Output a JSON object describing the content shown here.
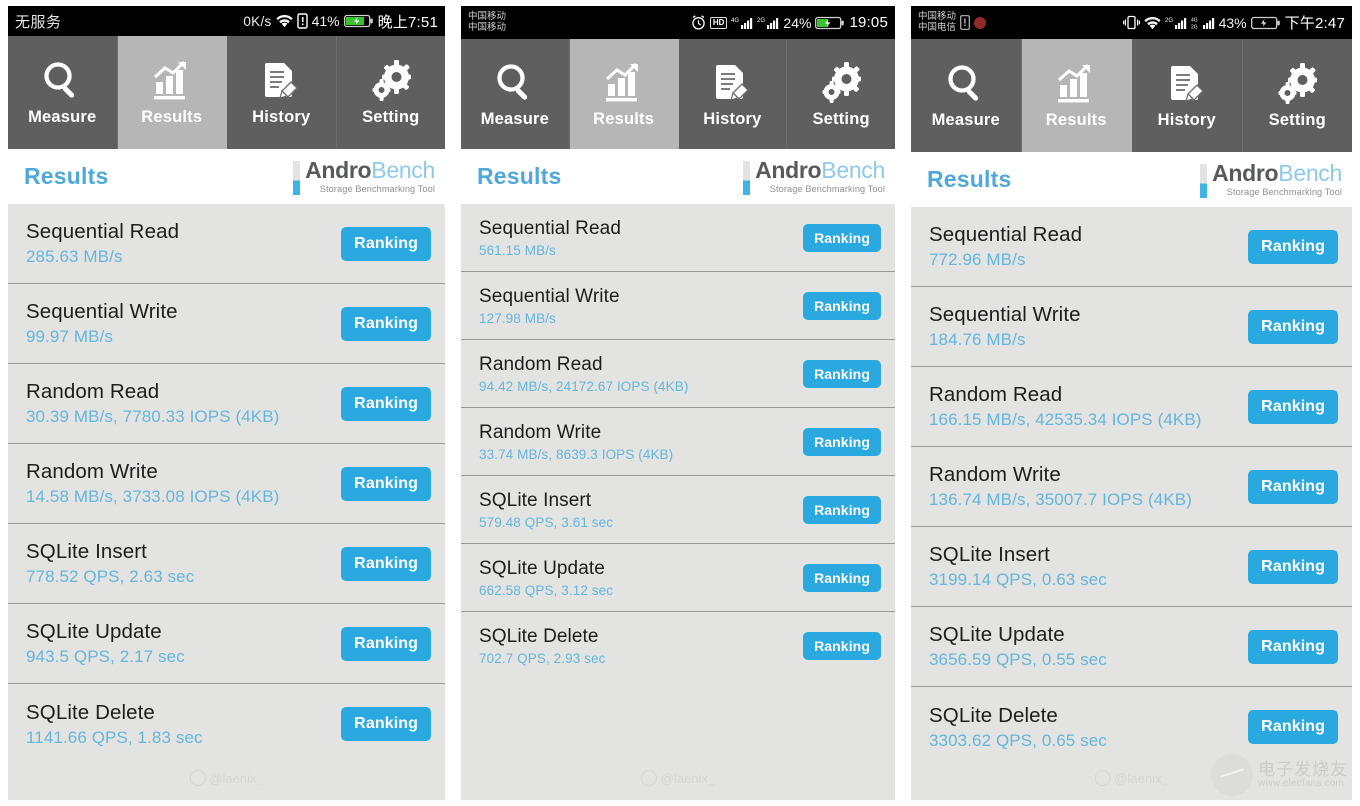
{
  "app": {
    "title": "Results",
    "logo_main_dark": "Andro",
    "logo_main_light": "Bench",
    "logo_tagline": "Storage Benchmarking Tool",
    "accent_blue": "#2aa9e0",
    "value_blue": "#64b6dd",
    "title_blue": "#4fa9d8",
    "tab_inactive_bg": "#5f5f5f",
    "tab_active_bg": "#b6b6b6",
    "list_bg": "#e3e3e1"
  },
  "tabs": [
    {
      "label": "Measure",
      "icon": "magnifier-icon",
      "active": false
    },
    {
      "label": "Results",
      "icon": "bar-chart-icon",
      "active": true
    },
    {
      "label": "History",
      "icon": "document-pencil-icon",
      "active": false
    },
    {
      "label": "Setting",
      "icon": "gears-icon",
      "active": false
    }
  ],
  "ranking_label": "Ranking",
  "watermarks": {
    "weibo": "@laenix_",
    "fans_cn": "电子发烧友",
    "fans_url": "www.elecfans.com"
  },
  "panels": [
    {
      "statusbar": {
        "carrier": "无服务",
        "carrier_line2": "",
        "net_speed": "0K/s",
        "battery_pct": "41%",
        "clock": "晚上7:51",
        "icons": [
          "wifi-icon",
          "sim-alert-icon",
          "battery-charging-icon"
        ]
      },
      "results": [
        {
          "name": "Sequential Read",
          "value": "285.63 MB/s"
        },
        {
          "name": "Sequential Write",
          "value": "99.97 MB/s"
        },
        {
          "name": "Random Read",
          "value": "30.39 MB/s, 7780.33 IOPS (4KB)"
        },
        {
          "name": "Random Write",
          "value": "14.58 MB/s, 3733.08 IOPS (4KB)"
        },
        {
          "name": "SQLite Insert",
          "value": "778.52 QPS, 2.63 sec"
        },
        {
          "name": "SQLite Update",
          "value": "943.5 QPS, 2.17 sec"
        },
        {
          "name": "SQLite Delete",
          "value": "1141.66 QPS, 1.83 sec"
        }
      ]
    },
    {
      "statusbar": {
        "carrier": "中国移动",
        "carrier_line2": "中国移动",
        "net_speed": "",
        "battery_pct": "24%",
        "clock": "19:05",
        "hd_badge": "HD",
        "signal_4g": "4G",
        "signal_2g": "2G",
        "icons": [
          "alarm-icon",
          "hd-icon",
          "signal-4g-icon",
          "signal-2g-icon",
          "battery-charging-icon"
        ]
      },
      "results": [
        {
          "name": "Sequential Read",
          "value": "561.15 MB/s"
        },
        {
          "name": "Sequential Write",
          "value": "127.98 MB/s"
        },
        {
          "name": "Random Read",
          "value": "94.42 MB/s, 24172.67 IOPS (4KB)"
        },
        {
          "name": "Random Write",
          "value": "33.74 MB/s, 8639.3 IOPS (4KB)"
        },
        {
          "name": "SQLite Insert",
          "value": "579.48 QPS, 3.61 sec"
        },
        {
          "name": "SQLite Update",
          "value": "662.58 QPS, 3.12 sec"
        },
        {
          "name": "SQLite Delete",
          "value": "702.7 QPS, 2.93 sec"
        }
      ]
    },
    {
      "statusbar": {
        "carrier": "中国移动",
        "carrier_line2": "中国电信",
        "net_speed": "",
        "battery_pct": "43%",
        "clock": "下午2:47",
        "signal_2g": "2G",
        "signal_4g": "4G",
        "icons": [
          "vibrate-icon",
          "wifi-icon",
          "signal-2g-icon",
          "signal-4g-icon",
          "battery-charging-icon",
          "sim-icon",
          "notification-badge-icon"
        ]
      },
      "results": [
        {
          "name": "Sequential Read",
          "value": "772.96 MB/s"
        },
        {
          "name": "Sequential Write",
          "value": "184.76 MB/s"
        },
        {
          "name": "Random Read",
          "value": "166.15 MB/s, 42535.34 IOPS (4KB)"
        },
        {
          "name": "Random Write",
          "value": "136.74 MB/s, 35007.7 IOPS (4KB)"
        },
        {
          "name": "SQLite Insert",
          "value": "3199.14 QPS, 0.63 sec"
        },
        {
          "name": "SQLite Update",
          "value": "3656.59 QPS, 0.55 sec"
        },
        {
          "name": "SQLite Delete",
          "value": "3303.62 QPS, 0.65 sec"
        }
      ]
    }
  ]
}
